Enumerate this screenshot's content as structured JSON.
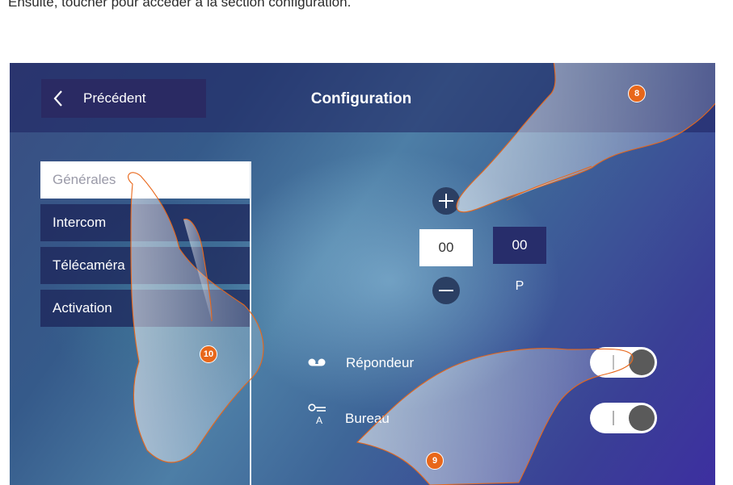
{
  "caption": "Ensuite, toucher pour accéder à la section configuration.",
  "header": {
    "back_label": "Précédent",
    "title": "Configuration"
  },
  "menu": {
    "items": [
      {
        "label": "Générales",
        "active": true
      },
      {
        "label": "Intercom",
        "active": false
      },
      {
        "label": "Télécaméra",
        "active": false
      },
      {
        "label": "Activation",
        "active": false
      }
    ]
  },
  "address": {
    "value_left": "00",
    "value_right": "00",
    "right_label": "P"
  },
  "settings": {
    "answering_machine_label": "Répondeur",
    "answering_machine_on": true,
    "office_label": "Bureau",
    "office_on": true
  },
  "badges": {
    "badge_8": "8",
    "badge_9": "9",
    "badge_10": "10"
  },
  "colors": {
    "accent": "#e8671a",
    "button_dark": "#2a2a63",
    "screen_blue": "#3a4d82"
  },
  "icons": [
    "chevron-left-icon",
    "plus-icon",
    "minus-icon",
    "voicemail-icon",
    "key-icon"
  ]
}
